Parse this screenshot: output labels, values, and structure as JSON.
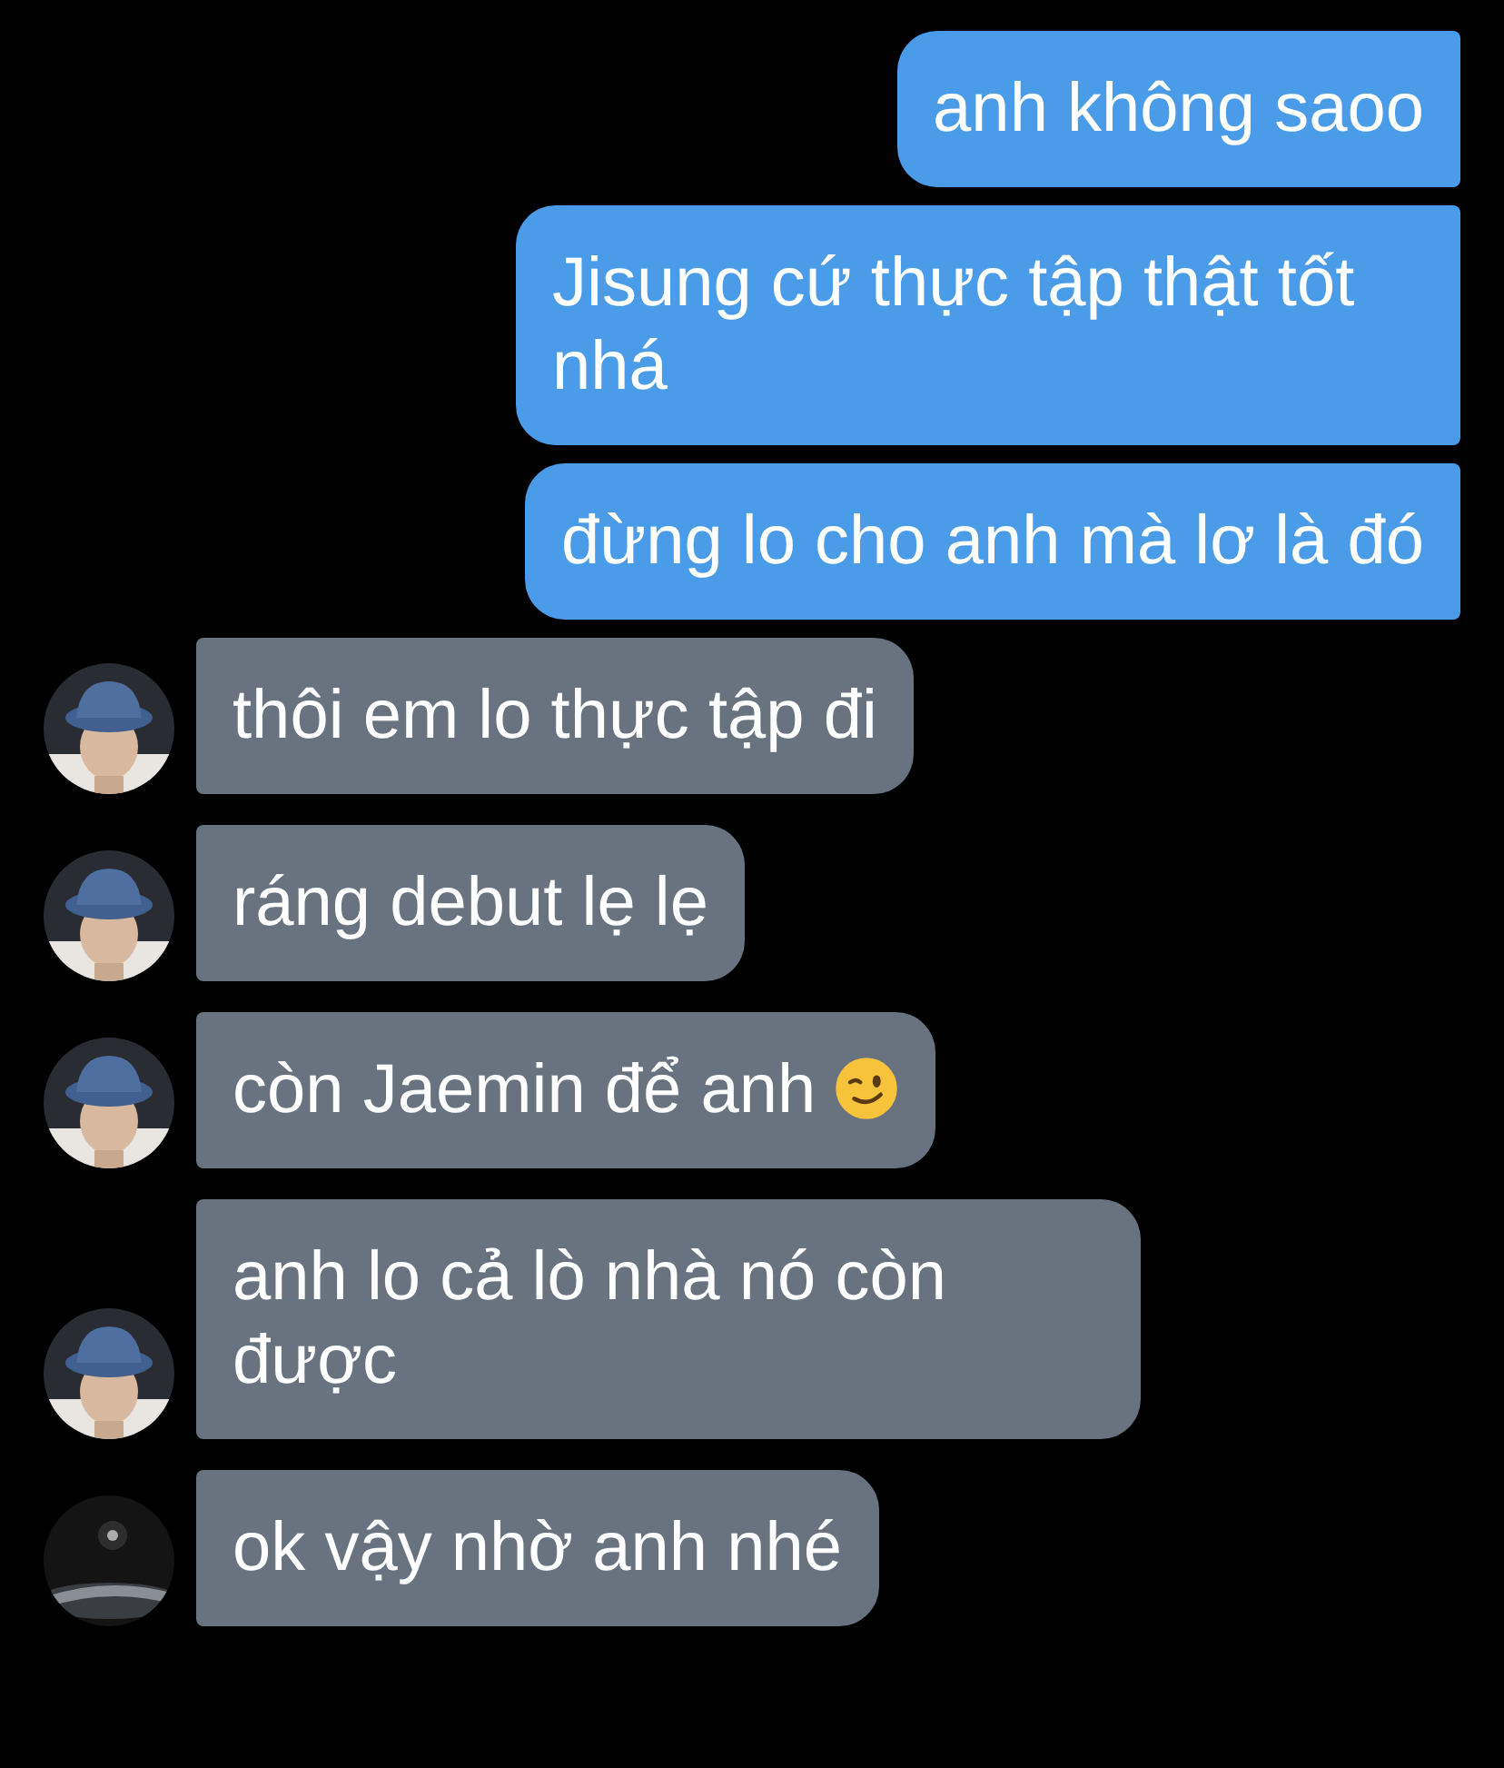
{
  "messages": [
    {
      "kind": "sent",
      "text": "anh không saoo",
      "has_emoji": false
    },
    {
      "kind": "sent",
      "text": "Jisung cứ thực tập thật tốt nhá",
      "has_emoji": false
    },
    {
      "kind": "sent",
      "text": "đừng lo cho anh mà lơ là đó",
      "has_emoji": false
    },
    {
      "kind": "received",
      "text": "thôi em lo thực tập đi",
      "has_emoji": false,
      "avatar": {
        "kind": "hat"
      }
    },
    {
      "kind": "received",
      "text": "ráng debut lẹ lẹ",
      "has_emoji": false,
      "avatar": {
        "kind": "hat"
      }
    },
    {
      "kind": "received",
      "text": "còn Jaemin để anh",
      "has_emoji": true,
      "avatar": {
        "kind": "hat"
      }
    },
    {
      "kind": "received",
      "text": "anh lo cả lò nhà nó còn được",
      "has_emoji": false,
      "avatar": {
        "kind": "hat"
      }
    },
    {
      "kind": "received",
      "text": "ok vậy nhờ anh nhé",
      "has_emoji": false,
      "avatar": {
        "kind": "dark"
      }
    }
  ]
}
